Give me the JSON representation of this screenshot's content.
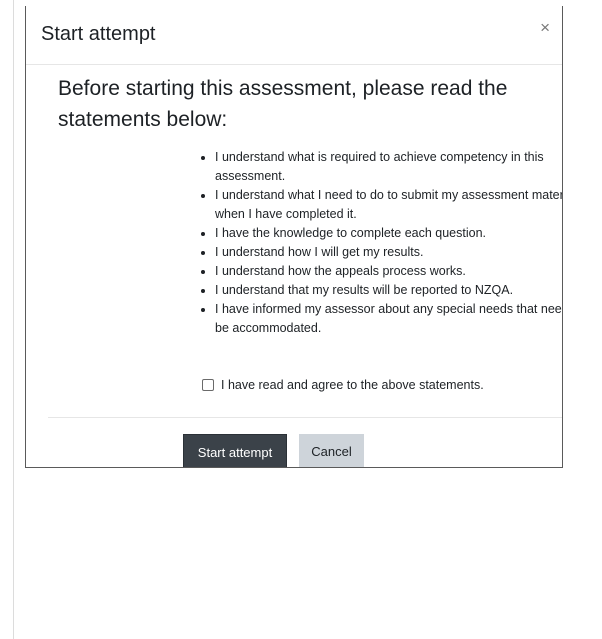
{
  "dialog": {
    "title": "Start attempt",
    "close_label": "×",
    "intro": "Before starting this assessment, please read the statements below:",
    "statements": [
      "I understand what is required to achieve competency in this assessment.",
      "I understand what I need to do to submit my assessment material when I have completed it.",
      "I have the knowledge to complete each question.",
      "I understand how I will get my results.",
      "I understand how the appeals process works.",
      "I understand that my results will be reported to NZQA.",
      "I have informed my assessor about any special needs that need to be accommodated."
    ],
    "agree_label": "I have read and agree to the above statements.",
    "agree_checked": false,
    "start_button": "Start attempt",
    "cancel_button": "Cancel"
  }
}
